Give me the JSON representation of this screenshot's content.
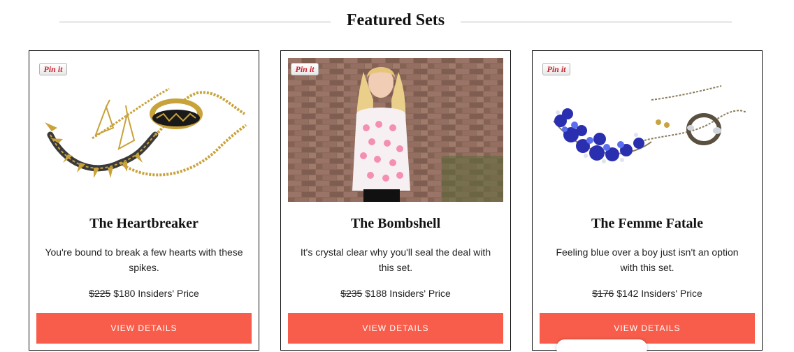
{
  "header": {
    "title": "Featured Sets"
  },
  "pin_label": "Pin it",
  "cards": [
    {
      "title": "The Heartbreaker",
      "description": "You're bound to break a few hearts with these spikes.",
      "old_price": "$225",
      "new_price": "$180",
      "price_note": "Insiders' Price",
      "button": "VIEW DETAILS"
    },
    {
      "title": "The Bombshell",
      "description": "It's crystal clear why you'll seal the deal with this set.",
      "old_price": "$235",
      "new_price": "$188",
      "price_note": "Insiders' Price",
      "button": "VIEW DETAILS"
    },
    {
      "title": "The Femme Fatale",
      "description": "Feeling blue over a boy just isn't an option with this set.",
      "old_price": "$176",
      "new_price": "$142",
      "price_note": "Insiders' Price",
      "button": "VIEW DETAILS"
    }
  ],
  "colors": {
    "button": "#f75d4a",
    "pin": "#c8232c",
    "card_border": "#111111"
  }
}
